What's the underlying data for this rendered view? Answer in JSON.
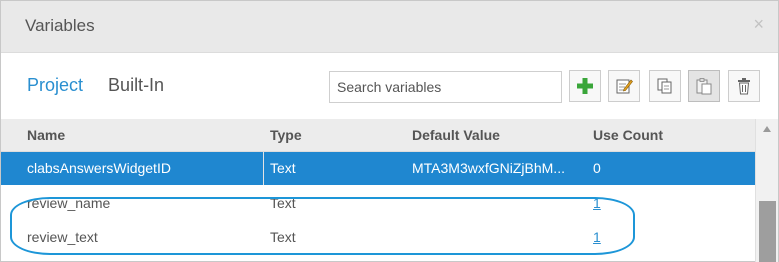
{
  "dialog": {
    "title": "Variables",
    "close_glyph": "×"
  },
  "tabs": [
    {
      "label": "Project",
      "active": true
    },
    {
      "label": "Built-In",
      "active": false
    }
  ],
  "search": {
    "placeholder": "Search variables",
    "value": ""
  },
  "toolbar": {
    "buttons": [
      {
        "icon": "add-icon"
      },
      {
        "icon": "edit-icon"
      },
      {
        "icon": "copy-icon"
      },
      {
        "icon": "paste-icon"
      },
      {
        "icon": "trash-icon"
      }
    ]
  },
  "colors": {
    "accent": "#2a8fd0",
    "selected_row": "#1f87d0",
    "add_green": "#3aa63a",
    "highlight_outline": "#1d96d8"
  },
  "table": {
    "columns": [
      "Name",
      "Type",
      "Default Value",
      "Use Count"
    ],
    "rows": [
      {
        "name": "clabsAnswersWidgetID",
        "type": "Text",
        "default_value": "MTA3M3wxfGNiZjBhM...",
        "use_count": "0",
        "selected": true
      },
      {
        "name": "review_name",
        "type": "Text",
        "default_value": "",
        "use_count": "1",
        "selected": false
      },
      {
        "name": "review_text",
        "type": "Text",
        "default_value": "",
        "use_count": "1",
        "selected": false
      }
    ]
  }
}
